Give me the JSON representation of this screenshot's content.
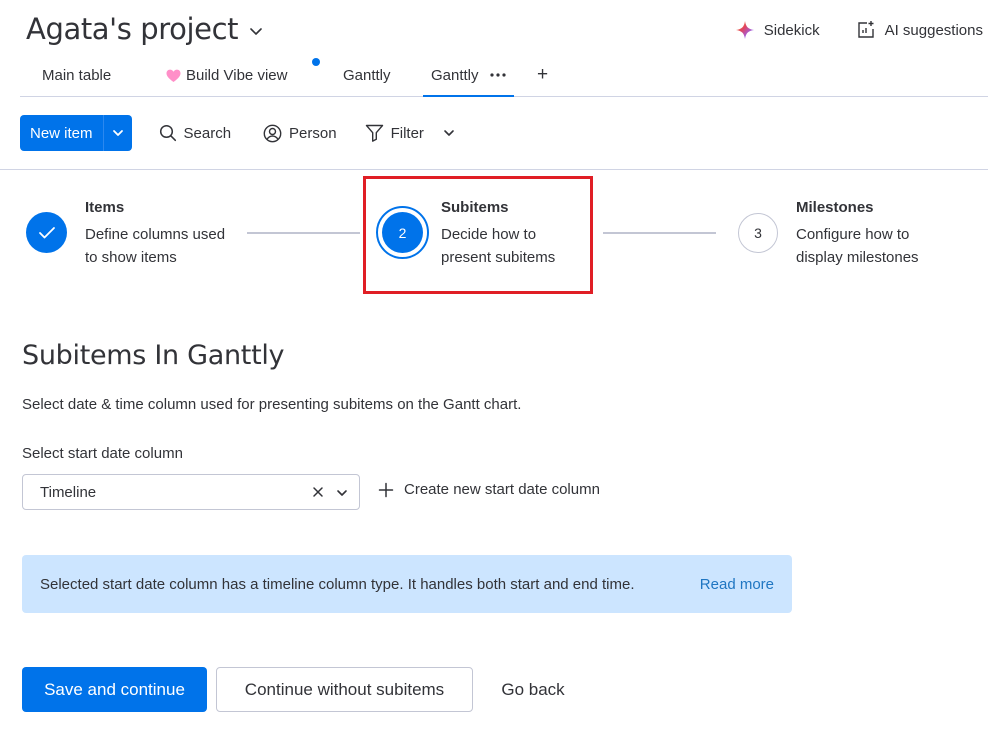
{
  "header": {
    "title": "Agata's project",
    "actions": [
      {
        "label": "Sidekick",
        "icon": "sparkle-icon"
      },
      {
        "label": "AI suggestions",
        "icon": "ai-suggestions-icon"
      }
    ]
  },
  "tabs": [
    {
      "label": "Main table",
      "active": false
    },
    {
      "label": "Build Vibe view",
      "active": false,
      "icon": "heart-icon",
      "has_dot": true
    },
    {
      "label": "Ganttly",
      "active": false
    },
    {
      "label": "Ganttly",
      "active": true
    }
  ],
  "toolbar": {
    "new_item": "New item",
    "search": "Search",
    "person": "Person",
    "filter": "Filter"
  },
  "stepper": {
    "steps": [
      {
        "number": "1",
        "title": "Items",
        "desc": "Define columns used to show items",
        "state": "complete"
      },
      {
        "number": "2",
        "title": "Subitems",
        "desc": "Decide how to present subitems",
        "state": "current"
      },
      {
        "number": "3",
        "title": "Milestones",
        "desc": "Configure how to display milestones",
        "state": "upcoming"
      }
    ]
  },
  "section": {
    "title": "Subitems In Ganttly",
    "subtitle": "Select date & time column used for presenting subitems on the Gantt chart."
  },
  "start_date": {
    "label": "Select start date column",
    "value": "Timeline",
    "create_label": "Create new start date column"
  },
  "info": {
    "text": "Selected start date column has a timeline column type. It handles both start and end time.",
    "link": "Read more"
  },
  "buttons": {
    "save": "Save and continue",
    "skip": "Continue without subitems",
    "back": "Go back"
  },
  "colors": {
    "primary": "#0073ea",
    "highlight": "#e01e25",
    "info_bg": "#cce5ff",
    "link": "#1f76c2"
  }
}
